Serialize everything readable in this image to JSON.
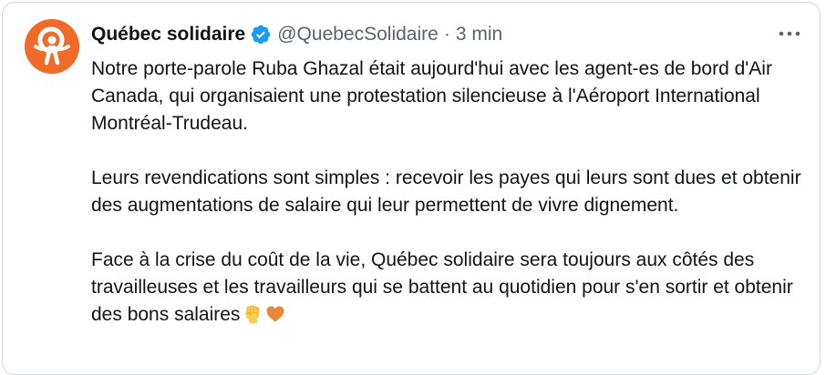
{
  "tweet": {
    "author": {
      "display_name": "Québec solidaire",
      "handle": "@QuebecSolidaire",
      "verified": true,
      "avatar_icon": "quebec-solidaire-logo",
      "avatar_color": "#f06a2a"
    },
    "separator": "·",
    "time": "3 min",
    "more_icon": "ellipsis-icon",
    "paragraphs": [
      "Notre porte-parole Ruba Ghazal était aujourd'hui avec les agent-es de bord d'Air Canada, qui organisaient une protestation silencieuse à l'Aéroport International Montréal-Trudeau.",
      "Leurs revendications sont simples : recevoir les payes qui leurs sont dues et obtenir des augmentations de salaire qui leur permettent de vivre dignement.",
      "Face à la crise du coût de la vie, Québec solidaire sera toujours aux côtés des travailleuses et les travailleurs qui se battent au quotidien pour s'en sortir et obtenir des bons salaires"
    ],
    "emojis": [
      "raised-fist-icon",
      "orange-heart-icon"
    ]
  },
  "colors": {
    "text": "#0f1419",
    "secondary": "#536471",
    "verified_badge": "#1d9bf0",
    "border": "#cfd9de"
  }
}
